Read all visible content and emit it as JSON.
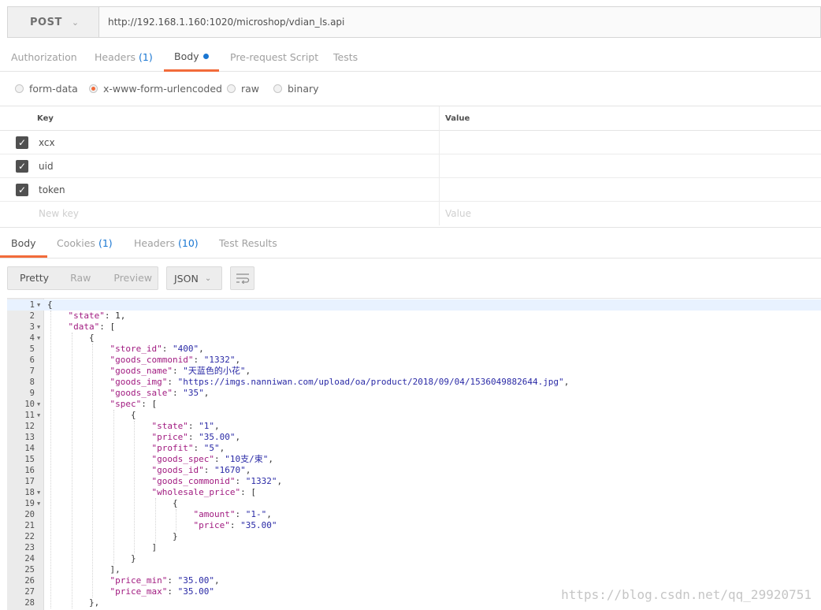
{
  "request": {
    "method": "POST",
    "url": "http://192.168.1.160:1020/microshop/vdian_ls.api"
  },
  "req_tabs": [
    {
      "label": "Authorization"
    },
    {
      "label": "Headers",
      "count": "(1)"
    },
    {
      "label": "Body"
    },
    {
      "label": "Pre-request Script"
    },
    {
      "label": "Tests"
    }
  ],
  "body_types": [
    "form-data",
    "x-www-form-urlencoded",
    "raw",
    "binary"
  ],
  "kv": {
    "key_header": "Key",
    "value_header": "Value",
    "rows": [
      {
        "key": "xcx",
        "value": ""
      },
      {
        "key": "uid",
        "value": ""
      },
      {
        "key": "token",
        "value": ""
      }
    ],
    "new_key_placeholder": "New key",
    "new_value_placeholder": "Value"
  },
  "resp_tabs": [
    {
      "label": "Body"
    },
    {
      "label": "Cookies",
      "count": "(1)"
    },
    {
      "label": "Headers",
      "count": "(10)"
    },
    {
      "label": "Test Results"
    }
  ],
  "view_modes": [
    "Pretty",
    "Raw",
    "Preview"
  ],
  "format": "JSON",
  "code_lines": [
    {
      "n": "1",
      "fold": true,
      "ind": 0,
      "t": [
        [
          "p",
          "{"
        ]
      ]
    },
    {
      "n": "2",
      "ind": 1,
      "t": [
        [
          "k",
          "\"state\""
        ],
        [
          "p",
          ": 1,"
        ]
      ]
    },
    {
      "n": "3",
      "fold": true,
      "ind": 1,
      "t": [
        [
          "k",
          "\"data\""
        ],
        [
          "p",
          ": ["
        ]
      ]
    },
    {
      "n": "4",
      "fold": true,
      "ind": 2,
      "t": [
        [
          "p",
          "{"
        ]
      ]
    },
    {
      "n": "5",
      "ind": 3,
      "t": [
        [
          "k",
          "\"store_id\""
        ],
        [
          "p",
          ": "
        ],
        [
          "s",
          "\"400\""
        ],
        [
          "p",
          ","
        ]
      ]
    },
    {
      "n": "6",
      "ind": 3,
      "t": [
        [
          "k",
          "\"goods_commonid\""
        ],
        [
          "p",
          ": "
        ],
        [
          "s",
          "\"1332\""
        ],
        [
          "p",
          ","
        ]
      ]
    },
    {
      "n": "7",
      "ind": 3,
      "t": [
        [
          "k",
          "\"goods_name\""
        ],
        [
          "p",
          ": "
        ],
        [
          "s",
          "\"天蓝色的小花\""
        ],
        [
          "p",
          ","
        ]
      ]
    },
    {
      "n": "8",
      "ind": 3,
      "t": [
        [
          "k",
          "\"goods_img\""
        ],
        [
          "p",
          ": "
        ],
        [
          "s",
          "\"https://imgs.nanniwan.com/upload/oa/product/2018/09/04/1536049882644.jpg\""
        ],
        [
          "p",
          ","
        ]
      ]
    },
    {
      "n": "9",
      "ind": 3,
      "t": [
        [
          "k",
          "\"goods_sale\""
        ],
        [
          "p",
          ": "
        ],
        [
          "s",
          "\"35\""
        ],
        [
          "p",
          ","
        ]
      ]
    },
    {
      "n": "10",
      "fold": true,
      "ind": 3,
      "t": [
        [
          "k",
          "\"spec\""
        ],
        [
          "p",
          ": ["
        ]
      ]
    },
    {
      "n": "11",
      "fold": true,
      "ind": 4,
      "t": [
        [
          "p",
          "{"
        ]
      ]
    },
    {
      "n": "12",
      "ind": 5,
      "t": [
        [
          "k",
          "\"state\""
        ],
        [
          "p",
          ": "
        ],
        [
          "s",
          "\"1\""
        ],
        [
          "p",
          ","
        ]
      ]
    },
    {
      "n": "13",
      "ind": 5,
      "t": [
        [
          "k",
          "\"price\""
        ],
        [
          "p",
          ": "
        ],
        [
          "s",
          "\"35.00\""
        ],
        [
          "p",
          ","
        ]
      ]
    },
    {
      "n": "14",
      "ind": 5,
      "t": [
        [
          "k",
          "\"profit\""
        ],
        [
          "p",
          ": "
        ],
        [
          "s",
          "\"5\""
        ],
        [
          "p",
          ","
        ]
      ]
    },
    {
      "n": "15",
      "ind": 5,
      "t": [
        [
          "k",
          "\"goods_spec\""
        ],
        [
          "p",
          ": "
        ],
        [
          "s",
          "\"10支/束\""
        ],
        [
          "p",
          ","
        ]
      ]
    },
    {
      "n": "16",
      "ind": 5,
      "t": [
        [
          "k",
          "\"goods_id\""
        ],
        [
          "p",
          ": "
        ],
        [
          "s",
          "\"1670\""
        ],
        [
          "p",
          ","
        ]
      ]
    },
    {
      "n": "17",
      "ind": 5,
      "t": [
        [
          "k",
          "\"goods_commonid\""
        ],
        [
          "p",
          ": "
        ],
        [
          "s",
          "\"1332\""
        ],
        [
          "p",
          ","
        ]
      ]
    },
    {
      "n": "18",
      "fold": true,
      "ind": 5,
      "t": [
        [
          "k",
          "\"wholesale_price\""
        ],
        [
          "p",
          ": ["
        ]
      ]
    },
    {
      "n": "19",
      "fold": true,
      "ind": 6,
      "t": [
        [
          "p",
          "{"
        ]
      ]
    },
    {
      "n": "20",
      "ind": 7,
      "t": [
        [
          "k",
          "\"amount\""
        ],
        [
          "p",
          ": "
        ],
        [
          "s",
          "\"1-\""
        ],
        [
          "p",
          ","
        ]
      ]
    },
    {
      "n": "21",
      "ind": 7,
      "t": [
        [
          "k",
          "\"price\""
        ],
        [
          "p",
          ": "
        ],
        [
          "s",
          "\"35.00\""
        ]
      ]
    },
    {
      "n": "22",
      "ind": 6,
      "t": [
        [
          "p",
          "}"
        ]
      ]
    },
    {
      "n": "23",
      "ind": 5,
      "t": [
        [
          "p",
          "]"
        ]
      ]
    },
    {
      "n": "24",
      "ind": 4,
      "t": [
        [
          "p",
          "}"
        ]
      ]
    },
    {
      "n": "25",
      "ind": 3,
      "t": [
        [
          "p",
          "],"
        ]
      ]
    },
    {
      "n": "26",
      "ind": 3,
      "t": [
        [
          "k",
          "\"price_min\""
        ],
        [
          "p",
          ": "
        ],
        [
          "s",
          "\"35.00\""
        ],
        [
          "p",
          ","
        ]
      ]
    },
    {
      "n": "27",
      "ind": 3,
      "t": [
        [
          "k",
          "\"price_max\""
        ],
        [
          "p",
          ": "
        ],
        [
          "s",
          "\"35.00\""
        ]
      ]
    },
    {
      "n": "28",
      "ind": 2,
      "t": [
        [
          "p",
          "},"
        ]
      ]
    }
  ],
  "watermark": "https://blog.csdn.net/qq_29920751",
  "colors": {
    "accent": "#f26b3a",
    "link": "#1976d2",
    "json_key": "#a11b80",
    "json_string": "#2a2aa6"
  }
}
